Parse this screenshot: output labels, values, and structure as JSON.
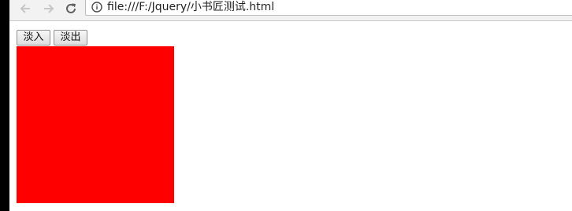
{
  "browser": {
    "url": "file:///F:/Jquery/小书匠测试.html",
    "icons": {
      "back": "arrow-left-icon",
      "forward": "arrow-right-icon",
      "reload": "reload-icon",
      "info": "info-icon"
    }
  },
  "page": {
    "buttons": {
      "fade_in_label": "淡入",
      "fade_out_label": "淡出"
    },
    "box_color": "#ff0000"
  }
}
